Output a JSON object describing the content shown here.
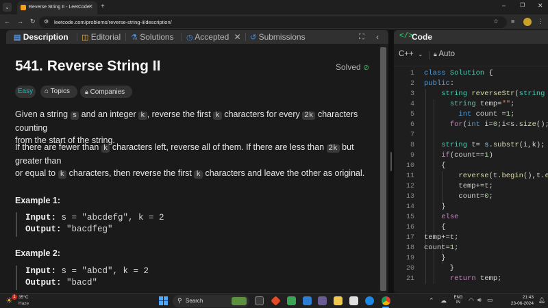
{
  "browser": {
    "tab_title": "Reverse String II - LeetCode",
    "url": "leetcode.com/problems/reverse-string-ii/description/"
  },
  "left_tabs": {
    "description": "Description",
    "editorial": "Editorial",
    "solutions": "Solutions",
    "accepted": "Accepted",
    "submissions": "Submissions"
  },
  "problem": {
    "title": "541. Reverse String II",
    "status": "Solved",
    "difficulty": "Easy",
    "topics": "Topics",
    "companies": "Companies",
    "para1": {
      "t1": "Given a string ",
      "c1": "s",
      "t2": " and an integer ",
      "c2": "k",
      "t3": ", reverse the first ",
      "c3": "k",
      "t4": " characters for every ",
      "c4": "2k",
      "t5": " characters counting",
      "t6": "from the start of the string."
    },
    "para2": {
      "t1": "If there are fewer than ",
      "c1": "k",
      "t2": " characters left, reverse all of them. If there are less than ",
      "c2": "2k",
      "t3": " but greater than",
      "t4": "or equal to ",
      "c3": "k",
      "t5": " characters, then reverse the first ",
      "c4": "k",
      "t6": " characters and leave the other as original."
    },
    "examples": [
      {
        "heading": "Example 1:",
        "input_label": "Input:",
        "input_value": " s = \"abcdefg\", k = 2",
        "output_label": "Output:",
        "output_value": " \"bacdfeg\""
      },
      {
        "heading": "Example 2:",
        "input_label": "Input:",
        "input_value": " s = \"abcd\", k = 2",
        "output_label": "Output:",
        "output_value": " \"bacd\""
      }
    ]
  },
  "code_panel": {
    "title": "Code",
    "language": "C++",
    "mode": "Auto",
    "line_numbers": [
      "1",
      "2",
      "3",
      "4",
      "5",
      "6",
      "7",
      "8",
      "9",
      "10",
      "11",
      "12",
      "13",
      "14",
      "15",
      "16",
      "17",
      "18",
      "19",
      "20",
      "21"
    ]
  },
  "taskbar": {
    "weather_temp": "35°C",
    "weather_desc": "Haze",
    "search_label": "Search",
    "lang": "ENG",
    "region": "IN",
    "time": "21:43",
    "date": "23-06-2024",
    "notification_count": "1"
  },
  "colors": {
    "accent_green": "#2cbb5d",
    "easy_teal": "#1cbaba",
    "code_keyword": "#569cd6",
    "code_title_icon": "#2cbb5d"
  }
}
